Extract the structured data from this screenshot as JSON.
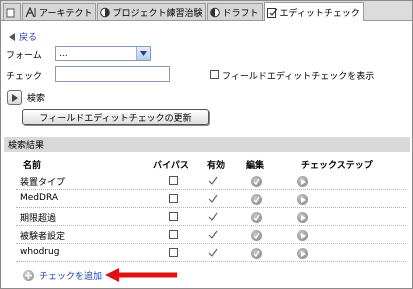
{
  "tabs": [
    {
      "label": "",
      "active": false
    },
    {
      "label": "アーキテクト",
      "active": false
    },
    {
      "label": "プロジェクト練習治験",
      "active": false
    },
    {
      "label": "ドラフト",
      "active": false
    },
    {
      "label": "エディットチェック",
      "active": true
    }
  ],
  "back_label": "戻る",
  "form": {
    "label": "フォーム",
    "selected": "..."
  },
  "check": {
    "label": "チェック",
    "value": ""
  },
  "show_field_edit_checks_label": "フィールドエディットチェックを表示",
  "search_label": "検索",
  "update_button_label": "フィールドエディットチェックの更新",
  "results": {
    "title": "検索結果",
    "columns": [
      "名前",
      "バイパス",
      "有効",
      "編集",
      "チェックステップ"
    ],
    "rows": [
      {
        "name": "装置タイプ",
        "bypass": false,
        "active": true
      },
      {
        "name": "MedDRA",
        "bypass": false,
        "active": true
      },
      {
        "name": "期限超過",
        "bypass": false,
        "active": true
      },
      {
        "name": "被験者設定",
        "bypass": false,
        "active": true
      },
      {
        "name": "whodrug",
        "bypass": false,
        "active": true
      }
    ]
  },
  "add_check_label": "チェックを追加",
  "colors": {
    "link": "#1a3fb3",
    "annotation_arrow": "#e01010",
    "section_bg": "#d9d9d9"
  }
}
